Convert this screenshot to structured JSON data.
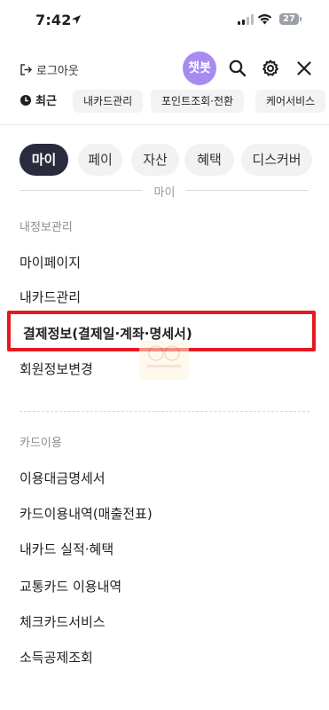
{
  "status_bar": {
    "time": "7:42",
    "battery": "27"
  },
  "header": {
    "logout_label": "로그아웃",
    "chatbot_label": "챗봇"
  },
  "recent": {
    "label": "최근",
    "chips": [
      "내카드관리",
      "포인트조회·전환",
      "케어서비스"
    ]
  },
  "tabs": [
    {
      "label": "마이",
      "active": true
    },
    {
      "label": "페이",
      "active": false
    },
    {
      "label": "자산",
      "active": false
    },
    {
      "label": "혜택",
      "active": false
    },
    {
      "label": "디스커버",
      "active": false
    }
  ],
  "section_title": "마이",
  "groups": [
    {
      "title": "내정보관리",
      "items": [
        "마이페이지",
        "내카드관리",
        "결제정보(결제일·계좌·명세서)",
        "회원정보변경"
      ]
    },
    {
      "title": "카드이용",
      "items": [
        "이용대금명세서",
        "카드이용내역(매출전표)",
        "내카드 실적·혜택",
        "교통카드 이용내역",
        "체크카드서비스",
        "소득공제조회"
      ]
    }
  ],
  "colors": {
    "accent_dark": "#2a2b3d",
    "highlight": "#e6181f",
    "chatbot": "#a78bf0"
  }
}
